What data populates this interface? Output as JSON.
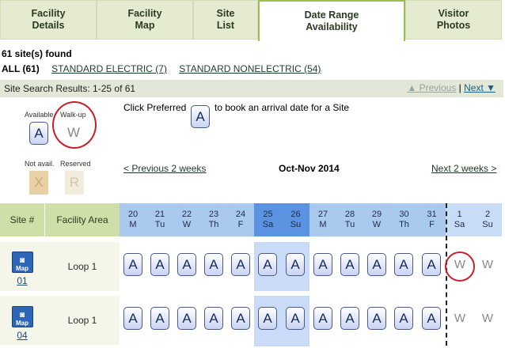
{
  "tabs": [
    {
      "label": "Facility\nDetails",
      "active": false
    },
    {
      "label": "Facility\nMap",
      "active": false
    },
    {
      "label": "Site\nList",
      "active": false
    },
    {
      "label": "Date Range\nAvailability",
      "active": true
    },
    {
      "label": "Visitor\nPhotos",
      "active": false
    }
  ],
  "found_text": "61 site(s) found",
  "filters": {
    "all": "ALL (61)",
    "electric": "STANDARD ELECTRIC (7)",
    "nonelectric": "STANDARD NONELECTRIC (54)"
  },
  "results": {
    "text": "Site Search Results: 1-25 of 61",
    "previous": "▲ Previous",
    "separator": "|",
    "next": "Next ▼"
  },
  "legend": {
    "available_label": "Available",
    "available_symbol": "A",
    "walkup_label": "Walk-up",
    "walkup_symbol": "W",
    "notavail_label": "Not avail.",
    "notavail_symbol": "X",
    "reserved_label": "Reserved",
    "reserved_symbol": "R",
    "instruction_before": "Click Preferred",
    "instruction_symbol": "A",
    "instruction_after": "to book an arrival date for a Site"
  },
  "nav": {
    "prev_weeks": "< Previous 2 weeks",
    "month": "Oct-Nov 2014",
    "next_weeks": "Next 2 weeks >"
  },
  "grid": {
    "site_header": "Site #",
    "area_header": "Facility Area",
    "days": [
      {
        "d": "20",
        "w": "M",
        "type": "day"
      },
      {
        "d": "21",
        "w": "Tu",
        "type": "day"
      },
      {
        "d": "22",
        "w": "W",
        "type": "day"
      },
      {
        "d": "23",
        "w": "Th",
        "type": "day"
      },
      {
        "d": "24",
        "w": "F",
        "type": "day"
      },
      {
        "d": "25",
        "w": "Sa",
        "type": "wknd"
      },
      {
        "d": "26",
        "w": "Su",
        "type": "wknd"
      },
      {
        "d": "27",
        "w": "M",
        "type": "day"
      },
      {
        "d": "28",
        "w": "Tu",
        "type": "day"
      },
      {
        "d": "29",
        "w": "W",
        "type": "day"
      },
      {
        "d": "30",
        "w": "Th",
        "type": "day"
      },
      {
        "d": "31",
        "w": "F",
        "type": "day"
      },
      {
        "d": "1",
        "w": "Sa",
        "type": "next"
      },
      {
        "d": "2",
        "w": "Su",
        "type": "next"
      }
    ],
    "rows": [
      {
        "map_label": "Map",
        "site": "01",
        "area": "Loop 1",
        "cells": [
          "A",
          "A",
          "A",
          "A",
          "A",
          "A",
          "A",
          "A",
          "A",
          "A",
          "A",
          "A",
          "W",
          "W"
        ]
      },
      {
        "map_label": "Map",
        "site": "04",
        "area": "Loop 1",
        "cells": [
          "A",
          "A",
          "A",
          "A",
          "A",
          "A",
          "A",
          "A",
          "A",
          "A",
          "A",
          "A",
          "W",
          "W"
        ]
      }
    ]
  },
  "colors": {
    "tab_bg": "#e4ebd0",
    "active_border": "#9cbf4f",
    "day_header": "#aac9ef",
    "weekend_header": "#5b93e0",
    "highlight_circle": "#c8202a"
  }
}
